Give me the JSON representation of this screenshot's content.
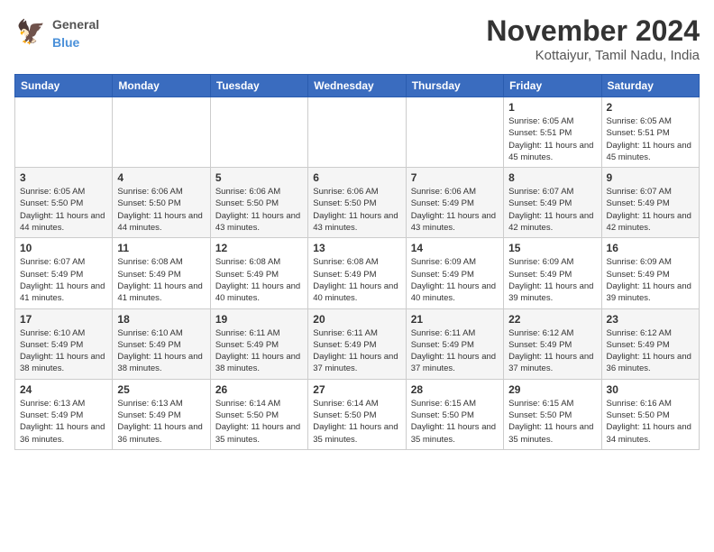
{
  "header": {
    "logo_general": "General",
    "logo_blue": "Blue",
    "month": "November 2024",
    "location": "Kottaiyur, Tamil Nadu, India"
  },
  "days_of_week": [
    "Sunday",
    "Monday",
    "Tuesday",
    "Wednesday",
    "Thursday",
    "Friday",
    "Saturday"
  ],
  "weeks": [
    [
      {
        "day": "",
        "info": ""
      },
      {
        "day": "",
        "info": ""
      },
      {
        "day": "",
        "info": ""
      },
      {
        "day": "",
        "info": ""
      },
      {
        "day": "",
        "info": ""
      },
      {
        "day": "1",
        "info": "Sunrise: 6:05 AM\nSunset: 5:51 PM\nDaylight: 11 hours and 45 minutes."
      },
      {
        "day": "2",
        "info": "Sunrise: 6:05 AM\nSunset: 5:51 PM\nDaylight: 11 hours and 45 minutes."
      }
    ],
    [
      {
        "day": "3",
        "info": "Sunrise: 6:05 AM\nSunset: 5:50 PM\nDaylight: 11 hours and 44 minutes."
      },
      {
        "day": "4",
        "info": "Sunrise: 6:06 AM\nSunset: 5:50 PM\nDaylight: 11 hours and 44 minutes."
      },
      {
        "day": "5",
        "info": "Sunrise: 6:06 AM\nSunset: 5:50 PM\nDaylight: 11 hours and 43 minutes."
      },
      {
        "day": "6",
        "info": "Sunrise: 6:06 AM\nSunset: 5:50 PM\nDaylight: 11 hours and 43 minutes."
      },
      {
        "day": "7",
        "info": "Sunrise: 6:06 AM\nSunset: 5:49 PM\nDaylight: 11 hours and 43 minutes."
      },
      {
        "day": "8",
        "info": "Sunrise: 6:07 AM\nSunset: 5:49 PM\nDaylight: 11 hours and 42 minutes."
      },
      {
        "day": "9",
        "info": "Sunrise: 6:07 AM\nSunset: 5:49 PM\nDaylight: 11 hours and 42 minutes."
      }
    ],
    [
      {
        "day": "10",
        "info": "Sunrise: 6:07 AM\nSunset: 5:49 PM\nDaylight: 11 hours and 41 minutes."
      },
      {
        "day": "11",
        "info": "Sunrise: 6:08 AM\nSunset: 5:49 PM\nDaylight: 11 hours and 41 minutes."
      },
      {
        "day": "12",
        "info": "Sunrise: 6:08 AM\nSunset: 5:49 PM\nDaylight: 11 hours and 40 minutes."
      },
      {
        "day": "13",
        "info": "Sunrise: 6:08 AM\nSunset: 5:49 PM\nDaylight: 11 hours and 40 minutes."
      },
      {
        "day": "14",
        "info": "Sunrise: 6:09 AM\nSunset: 5:49 PM\nDaylight: 11 hours and 40 minutes."
      },
      {
        "day": "15",
        "info": "Sunrise: 6:09 AM\nSunset: 5:49 PM\nDaylight: 11 hours and 39 minutes."
      },
      {
        "day": "16",
        "info": "Sunrise: 6:09 AM\nSunset: 5:49 PM\nDaylight: 11 hours and 39 minutes."
      }
    ],
    [
      {
        "day": "17",
        "info": "Sunrise: 6:10 AM\nSunset: 5:49 PM\nDaylight: 11 hours and 38 minutes."
      },
      {
        "day": "18",
        "info": "Sunrise: 6:10 AM\nSunset: 5:49 PM\nDaylight: 11 hours and 38 minutes."
      },
      {
        "day": "19",
        "info": "Sunrise: 6:11 AM\nSunset: 5:49 PM\nDaylight: 11 hours and 38 minutes."
      },
      {
        "day": "20",
        "info": "Sunrise: 6:11 AM\nSunset: 5:49 PM\nDaylight: 11 hours and 37 minutes."
      },
      {
        "day": "21",
        "info": "Sunrise: 6:11 AM\nSunset: 5:49 PM\nDaylight: 11 hours and 37 minutes."
      },
      {
        "day": "22",
        "info": "Sunrise: 6:12 AM\nSunset: 5:49 PM\nDaylight: 11 hours and 37 minutes."
      },
      {
        "day": "23",
        "info": "Sunrise: 6:12 AM\nSunset: 5:49 PM\nDaylight: 11 hours and 36 minutes."
      }
    ],
    [
      {
        "day": "24",
        "info": "Sunrise: 6:13 AM\nSunset: 5:49 PM\nDaylight: 11 hours and 36 minutes."
      },
      {
        "day": "25",
        "info": "Sunrise: 6:13 AM\nSunset: 5:49 PM\nDaylight: 11 hours and 36 minutes."
      },
      {
        "day": "26",
        "info": "Sunrise: 6:14 AM\nSunset: 5:50 PM\nDaylight: 11 hours and 35 minutes."
      },
      {
        "day": "27",
        "info": "Sunrise: 6:14 AM\nSunset: 5:50 PM\nDaylight: 11 hours and 35 minutes."
      },
      {
        "day": "28",
        "info": "Sunrise: 6:15 AM\nSunset: 5:50 PM\nDaylight: 11 hours and 35 minutes."
      },
      {
        "day": "29",
        "info": "Sunrise: 6:15 AM\nSunset: 5:50 PM\nDaylight: 11 hours and 35 minutes."
      },
      {
        "day": "30",
        "info": "Sunrise: 6:16 AM\nSunset: 5:50 PM\nDaylight: 11 hours and 34 minutes."
      }
    ]
  ]
}
